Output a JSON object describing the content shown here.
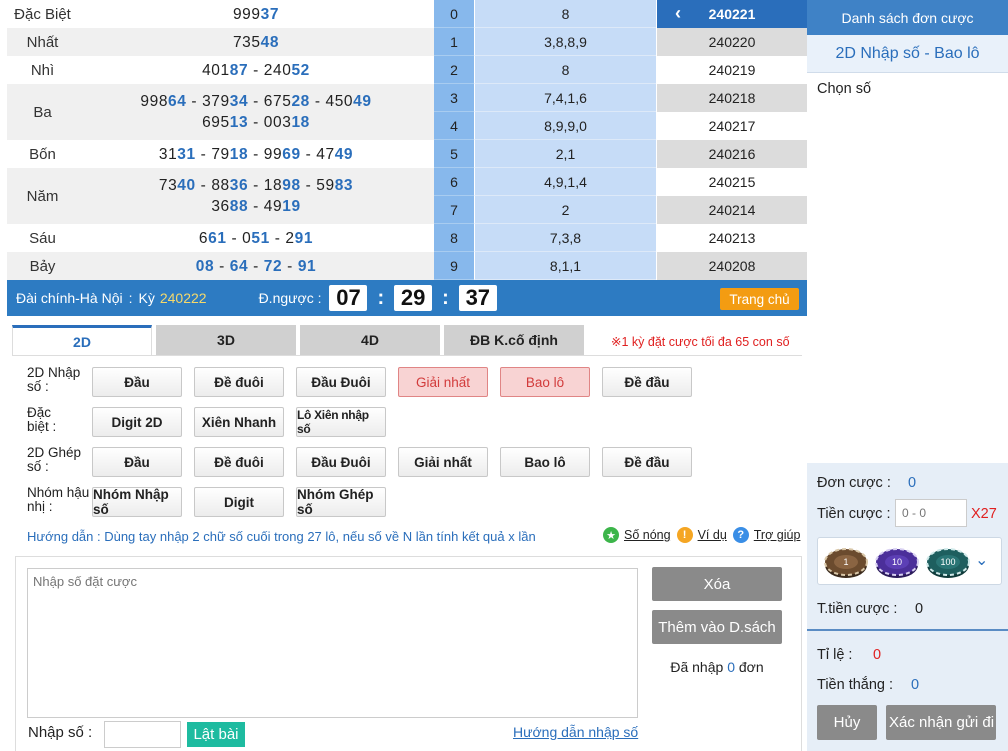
{
  "results": [
    {
      "label": "Đặc Biệt",
      "lines": [
        [
          [
            "999",
            ""
          ],
          [
            "37",
            "b"
          ]
        ]
      ]
    },
    {
      "label": "Nhất",
      "lines": [
        [
          [
            "735",
            ""
          ],
          [
            "48",
            "b"
          ]
        ]
      ]
    },
    {
      "label": "Nhì",
      "lines": [
        [
          [
            "401",
            ""
          ],
          [
            "87",
            "b"
          ],
          [
            " - 240",
            ""
          ],
          [
            "52",
            "b"
          ]
        ]
      ]
    },
    {
      "label": "Ba",
      "lines": [
        [
          [
            "998",
            ""
          ],
          [
            "64",
            "b"
          ],
          [
            " - 379",
            ""
          ],
          [
            "34",
            "b"
          ],
          [
            " - 675",
            ""
          ],
          [
            "28",
            "b"
          ],
          [
            " - 450",
            ""
          ],
          [
            "49",
            "b"
          ]
        ],
        [
          [
            "695",
            ""
          ],
          [
            "13",
            "b"
          ],
          [
            " - 003",
            ""
          ],
          [
            "18",
            "b"
          ]
        ]
      ]
    },
    {
      "label": "Bốn",
      "lines": [
        [
          [
            "31",
            ""
          ],
          [
            "31",
            "b"
          ],
          [
            " - 79",
            ""
          ],
          [
            "18",
            "b"
          ],
          [
            " - 99",
            ""
          ],
          [
            "69",
            "b"
          ],
          [
            " - 47",
            ""
          ],
          [
            "49",
            "b"
          ]
        ]
      ]
    },
    {
      "label": "Năm",
      "lines": [
        [
          [
            "73",
            ""
          ],
          [
            "40",
            "b"
          ],
          [
            " - 88",
            ""
          ],
          [
            "36",
            "b"
          ],
          [
            " - 18",
            ""
          ],
          [
            "98",
            "b"
          ],
          [
            " - 59",
            ""
          ],
          [
            "83",
            "b"
          ]
        ],
        [
          [
            "36",
            ""
          ],
          [
            "88",
            "b"
          ],
          [
            " - 49",
            ""
          ],
          [
            "19",
            "b"
          ]
        ]
      ]
    },
    {
      "label": "Sáu",
      "lines": [
        [
          [
            "6",
            ""
          ],
          [
            "61",
            "b"
          ],
          [
            " - 0",
            ""
          ],
          [
            "51",
            "b"
          ],
          [
            " - 2",
            ""
          ],
          [
            "91",
            "b"
          ]
        ]
      ]
    },
    {
      "label": "Bảy",
      "lines": [
        [
          [
            "08",
            "b"
          ],
          [
            " - ",
            ""
          ],
          [
            "64",
            "b"
          ],
          [
            " - ",
            ""
          ],
          [
            "72",
            "b"
          ],
          [
            " - ",
            ""
          ],
          [
            "91",
            "b"
          ]
        ]
      ]
    }
  ],
  "digits": [
    {
      "n": "0",
      "v": "8"
    },
    {
      "n": "1",
      "v": "3,8,8,9"
    },
    {
      "n": "2",
      "v": "8"
    },
    {
      "n": "3",
      "v": "7,4,1,6"
    },
    {
      "n": "4",
      "v": "8,9,9,0"
    },
    {
      "n": "5",
      "v": "2,1"
    },
    {
      "n": "6",
      "v": "4,9,1,4"
    },
    {
      "n": "7",
      "v": "2"
    },
    {
      "n": "8",
      "v": "7,3,8"
    },
    {
      "n": "9",
      "v": "8,1,1"
    }
  ],
  "periods": [
    "240221",
    "240220",
    "240219",
    "240218",
    "240217",
    "240216",
    "240215",
    "240214",
    "240213",
    "240208"
  ],
  "status": {
    "region": "Đài chính-Hà Nội",
    "ky_label": "Kỳ",
    "ky_value": "240222",
    "countdown_label": "Đ.ngược :",
    "hh": "07",
    "mm": "29",
    "ss": "37",
    "home": "Trang chủ"
  },
  "tabs": [
    "2D",
    "3D",
    "4D",
    "ĐB K.cố định"
  ],
  "limit_note": "※1 kỳ đặt cược tối đa 65 con số",
  "rows": [
    {
      "label": "2D Nhập\nsố :",
      "buttons": [
        "Đầu",
        "Đề đuôi",
        "Đầu Đuôi",
        "Giải nhất",
        "Bao lô",
        "Đề đầu"
      ]
    },
    {
      "label": "Đặc\nbiệt :",
      "buttons": [
        "Digit 2D",
        "Xiên Nhanh",
        "Lô Xiên nhập số"
      ]
    },
    {
      "label": "2D Ghép\nsố :",
      "buttons": [
        "Đầu",
        "Đề đuôi",
        "Đầu Đuôi",
        "Giải nhất",
        "Bao lô",
        "Đề đầu"
      ]
    },
    {
      "label": "Nhóm hậu\nnhị :",
      "buttons": [
        "Nhóm Nhập số",
        "Digit",
        "Nhóm Ghép số"
      ]
    }
  ],
  "guide": "Hướng dẫn : Dùng tay nhập 2 chữ số cuối trong 27 lô, nếu số về N lần tính kết quả x lần",
  "links": {
    "hot": "Số nóng",
    "example": "Ví dụ",
    "help": "Trợ giúp"
  },
  "entry": {
    "placeholder": "Nhập số đặt cược",
    "delete": "Xóa",
    "add": "Thêm vào D.sách",
    "entered_pre": "Đã nhập",
    "entered_count": "0",
    "entered_post": "đơn",
    "input_label": "Nhập số :",
    "flip": "Lật bài",
    "input_guide": "Hướng dẫn nhập số"
  },
  "right": {
    "title": "Danh sách đơn cược",
    "subtitle": "2D Nhập số - Bao lô",
    "choose": "Chọn số",
    "order_label": "Đơn cược :",
    "order_value": "0",
    "bet_label": "Tiền cược :",
    "bet_placeholder": "0 - 0",
    "multiplier": "X27",
    "chips": [
      "1",
      "10",
      "100"
    ],
    "total_label": "T.tiền cược :",
    "total_value": "0",
    "rate_label": "Tỉ lệ :",
    "rate_value": "0",
    "win_label": "Tiền thắng :",
    "win_value": "0",
    "cancel": "Hủy",
    "confirm": "Xác nhận gửi đi"
  },
  "colors": {
    "accent": "#2a6ebb",
    "bar": "#2d7bc2",
    "orange": "#f39c12",
    "teal": "#1ebba0",
    "red": "#e02020"
  }
}
